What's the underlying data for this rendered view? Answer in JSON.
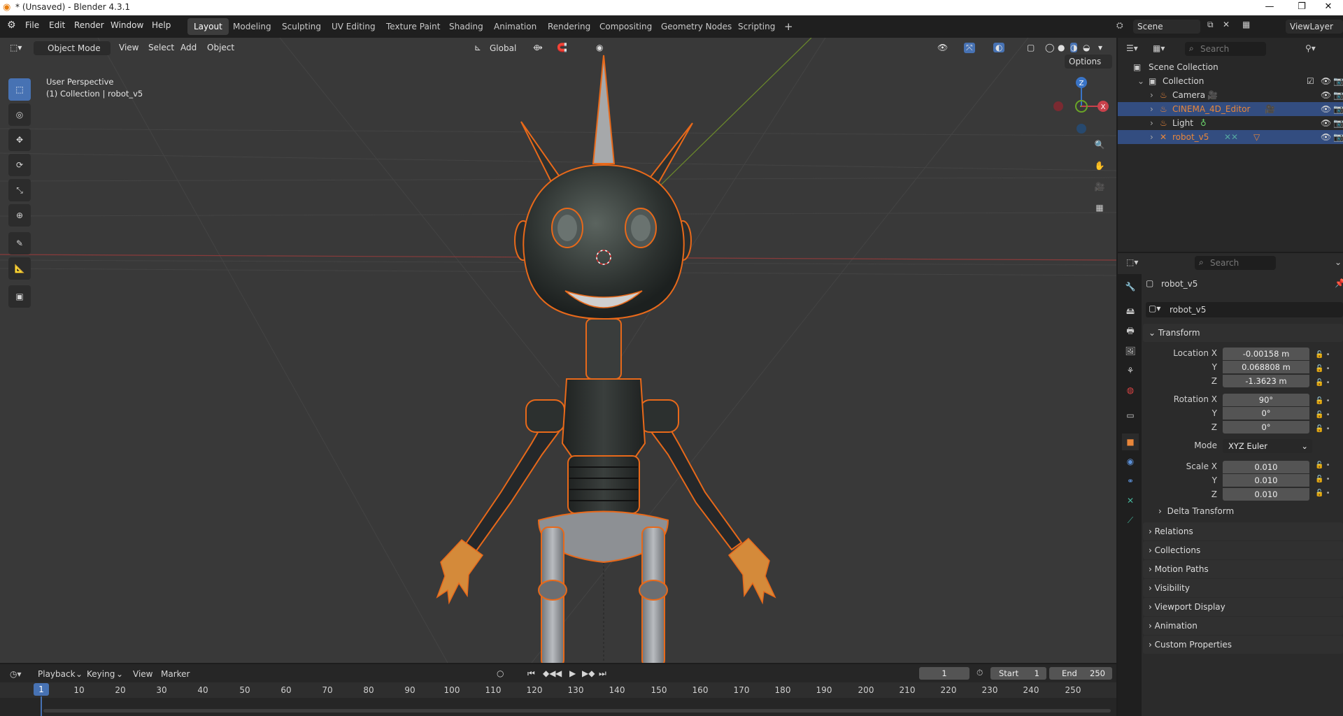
{
  "window": {
    "title": "* (Unsaved) - Blender 4.3.1"
  },
  "menu": [
    "File",
    "Edit",
    "Render",
    "Window",
    "Help"
  ],
  "workspaces": [
    "Layout",
    "Modeling",
    "Sculpting",
    "UV Editing",
    "Texture Paint",
    "Shading",
    "Animation",
    "Rendering",
    "Compositing",
    "Geometry Nodes",
    "Scripting"
  ],
  "active_workspace": "Layout",
  "scene": {
    "name": "Scene",
    "view_layer": "ViewLayer"
  },
  "viewport": {
    "mode": "Object Mode",
    "menus": [
      "View",
      "Select",
      "Add",
      "Object"
    ],
    "orientation": "Global",
    "options_label": "Options",
    "perspective": "User Perspective",
    "collection_info": "(1) Collection | robot_v5",
    "gizmo": {
      "z": "Z",
      "x": "X"
    }
  },
  "outliner": {
    "search_placeholder": "Search",
    "root": "Scene Collection",
    "collection": "Collection",
    "items": [
      {
        "name": "Camera",
        "color": "#d6d6d6"
      },
      {
        "name": "CINEMA_4D_Editor",
        "color": "#e8863a"
      },
      {
        "name": "Light",
        "color": "#d6d6d6"
      },
      {
        "name": "robot_v5",
        "color": "#e8863a"
      }
    ]
  },
  "properties": {
    "search_placeholder": "Search",
    "object_name": "robot_v5",
    "object_field": "robot_v5",
    "transform_label": "Transform",
    "location": {
      "label_x": "Location X",
      "x": "-0.00158 m",
      "y": "0.068808 m",
      "z": "-1.3623 m"
    },
    "rotation": {
      "label_x": "Rotation X",
      "x": "90°",
      "y": "0°",
      "z": "0°"
    },
    "mode_label": "Mode",
    "mode_value": "XYZ Euler",
    "scale": {
      "label_x": "Scale X",
      "x": "0.010",
      "y": "0.010",
      "z": "0.010"
    },
    "axis_y": "Y",
    "axis_z": "Z",
    "delta_transform": "Delta Transform",
    "panels": [
      "Relations",
      "Collections",
      "Motion Paths",
      "Visibility",
      "Viewport Display",
      "Animation",
      "Custom Properties"
    ]
  },
  "timeline": {
    "menus": [
      "Playback",
      "Keying",
      "View",
      "Marker"
    ],
    "current_frame": "1",
    "start_label": "Start",
    "start": "1",
    "end_label": "End",
    "end": "250",
    "ticks": [
      "10",
      "20",
      "30",
      "40",
      "50",
      "60",
      "70",
      "80",
      "90",
      "100",
      "110",
      "120",
      "130",
      "140",
      "150",
      "160",
      "170",
      "180",
      "190",
      "200",
      "210",
      "220",
      "230",
      "240",
      "250"
    ],
    "marker_frame": "1"
  },
  "colors": {
    "accent": "#4772b3",
    "selection": "#e8863a"
  }
}
